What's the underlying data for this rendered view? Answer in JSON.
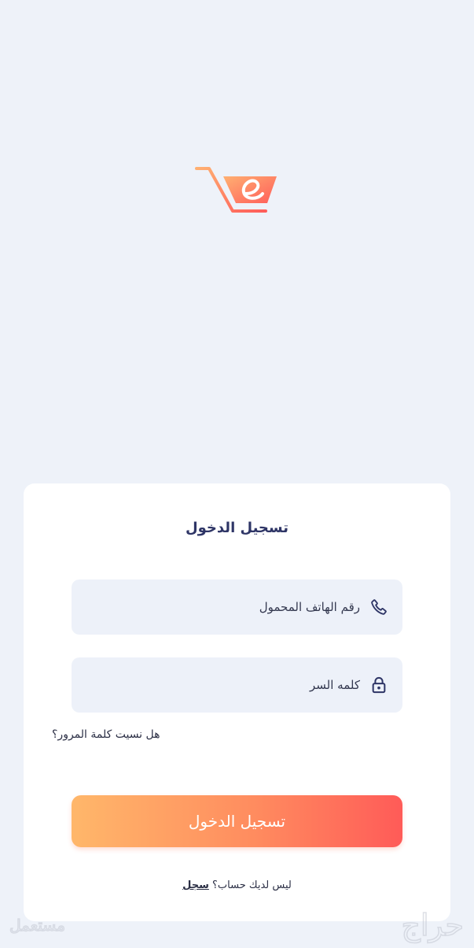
{
  "login": {
    "title": "تسجيل الدخول",
    "phone_placeholder": "رقم الهاتف المحمول",
    "password_placeholder": "كلمه السر",
    "forgot_password": "هل نسيت كلمة المرور؟",
    "submit_label": "تسجيل الدخول",
    "no_account_text": "ليس لديك حساب؟",
    "register_link": "سجل"
  },
  "icons": {
    "logo": "shopping-cart-logo",
    "phone": "phone-icon",
    "password": "lock-icon"
  },
  "colors": {
    "background": "#eef2f9",
    "card": "#ffffff",
    "field": "#edf1f9",
    "text_dark": "#2e3566",
    "button_start": "#ffb76a",
    "button_end": "#ff5b58"
  },
  "watermark": {
    "left_text": "مستعمل",
    "right_text": "حراج"
  }
}
